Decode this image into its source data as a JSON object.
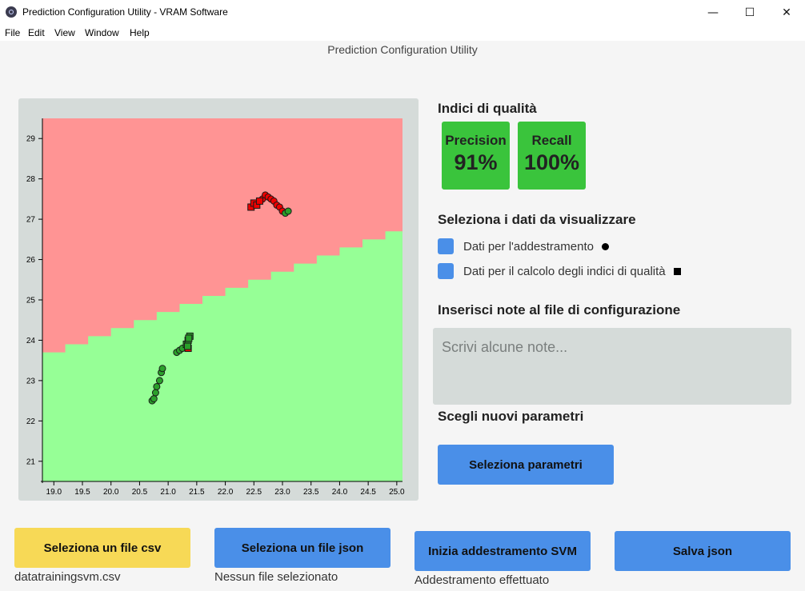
{
  "window": {
    "title": "Prediction Configuration Utility - VRAM Software",
    "minimize_glyph": "—",
    "maximize_glyph": "☐",
    "close_glyph": "✕"
  },
  "menu": [
    "File",
    "Edit",
    "View",
    "Window",
    "Help"
  ],
  "page_title": "Prediction Configuration Utility",
  "quality": {
    "heading": "Indici di qualità",
    "precision_label": "Precision",
    "precision_value": "91%",
    "recall_label": "Recall",
    "recall_value": "100%"
  },
  "visualize": {
    "heading": "Seleziona i dati da visualizzare",
    "training_label": "Dati per l'addestramento",
    "quality_label": "Dati per il calcolo degli indici di qualità"
  },
  "notes": {
    "heading": "Inserisci note al file di configurazione",
    "placeholder": "Scrivi alcune note..."
  },
  "params": {
    "heading": "Scegli nuovi parametri",
    "button": "Seleziona parametri"
  },
  "actions": {
    "csv_button": "Seleziona un file csv",
    "csv_caption": "datatrainingsvm.csv",
    "json_button": "Seleziona un file json",
    "json_caption": "Nessun file selezionato",
    "train_button": "Inizia addestramento SVM",
    "train_caption": "Addestramento effettuato",
    "save_button": "Salva json"
  },
  "colors": {
    "region_red": "#ff9494",
    "region_green": "#96ff96",
    "point_red": "#ee0000",
    "point_green": "#2aa02a",
    "accent_blue": "#4a8fe8",
    "metric_green": "#3ac43c",
    "button_yellow": "#f7d956"
  },
  "chart_data": {
    "type": "scatter",
    "xlim": [
      18.8,
      25.1
    ],
    "ylim": [
      20.5,
      29.5
    ],
    "x_ticks": [
      "19.0",
      "19.5",
      "20.0",
      "20.5",
      "21.0",
      "21.5",
      "22.0",
      "22.5",
      "23.0",
      "23.5",
      "24.0",
      "24.5",
      "25.0"
    ],
    "y_ticks": [
      "21",
      "22",
      "23",
      "24",
      "25",
      "26",
      "27",
      "28",
      "29"
    ],
    "boundary": [
      [
        18.8,
        23.7
      ],
      [
        19.2,
        23.9
      ],
      [
        19.6,
        24.1
      ],
      [
        20.0,
        24.3
      ],
      [
        20.4,
        24.5
      ],
      [
        20.8,
        24.7
      ],
      [
        21.2,
        24.9
      ],
      [
        21.6,
        25.1
      ],
      [
        22.0,
        25.3
      ],
      [
        22.4,
        25.5
      ],
      [
        22.8,
        25.7
      ],
      [
        23.2,
        25.9
      ],
      [
        23.6,
        26.1
      ],
      [
        24.0,
        26.3
      ],
      [
        24.4,
        26.5
      ],
      [
        24.8,
        26.7
      ],
      [
        25.1,
        26.7
      ]
    ],
    "series": [
      {
        "marker": "circle",
        "class": "red",
        "x": [
          22.55,
          22.6,
          22.65,
          22.7,
          22.75,
          22.8,
          22.85,
          22.9,
          22.95,
          23.0
        ],
        "y": [
          27.4,
          27.45,
          27.5,
          27.6,
          27.55,
          27.5,
          27.45,
          27.35,
          27.3,
          27.2
        ]
      },
      {
        "marker": "square",
        "class": "red",
        "x": [
          22.45,
          22.5,
          22.55,
          22.6,
          21.35
        ],
        "y": [
          27.3,
          27.4,
          27.35,
          27.45,
          23.8
        ]
      },
      {
        "marker": "circle",
        "class": "green",
        "x": [
          23.05,
          23.1,
          20.72,
          20.75,
          20.78,
          20.8,
          20.85,
          20.88,
          20.9,
          21.15,
          21.2,
          21.25
        ],
        "y": [
          27.15,
          27.2,
          22.5,
          22.55,
          22.7,
          22.85,
          23.0,
          23.2,
          23.3,
          23.7,
          23.75,
          23.8
        ]
      },
      {
        "marker": "square",
        "class": "green",
        "x": [
          21.32,
          21.35,
          21.38,
          21.34,
          21.36
        ],
        "y": [
          23.9,
          24.0,
          24.1,
          23.85,
          24.05
        ]
      }
    ]
  }
}
